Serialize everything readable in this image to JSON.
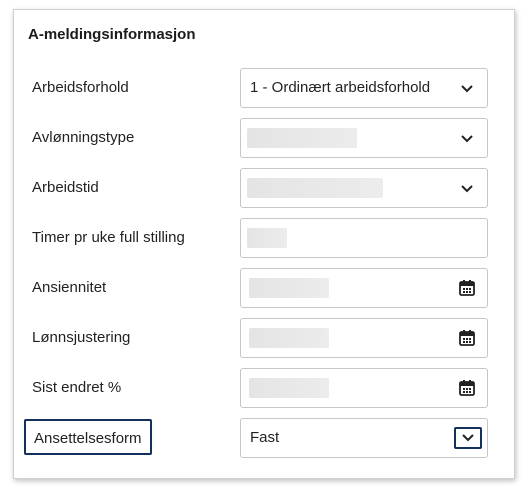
{
  "section": {
    "title": "A-meldingsinformasjon"
  },
  "fields": [
    {
      "label": "Arbeidsforhold",
      "type": "select",
      "value": "1 - Ordinært arbeidsforhold"
    },
    {
      "label": "Avlønningstype",
      "type": "select",
      "value": ""
    },
    {
      "label": "Arbeidstid",
      "type": "select",
      "value": ""
    },
    {
      "label": "Timer pr uke full stilling",
      "type": "text",
      "value": ""
    },
    {
      "label": "Ansiennitet",
      "type": "date",
      "value": ""
    },
    {
      "label": "Lønnsjustering",
      "type": "date",
      "value": ""
    },
    {
      "label": "Sist endret %",
      "type": "date",
      "value": ""
    },
    {
      "label": "Ansettelsesform",
      "type": "select",
      "value": "Fast",
      "focused": true
    }
  ],
  "icons": {
    "dropdown": "chevron-down-icon",
    "date": "calendar-icon"
  },
  "colors": {
    "focus_outline": "#13305f",
    "border": "#c6c6c6"
  }
}
